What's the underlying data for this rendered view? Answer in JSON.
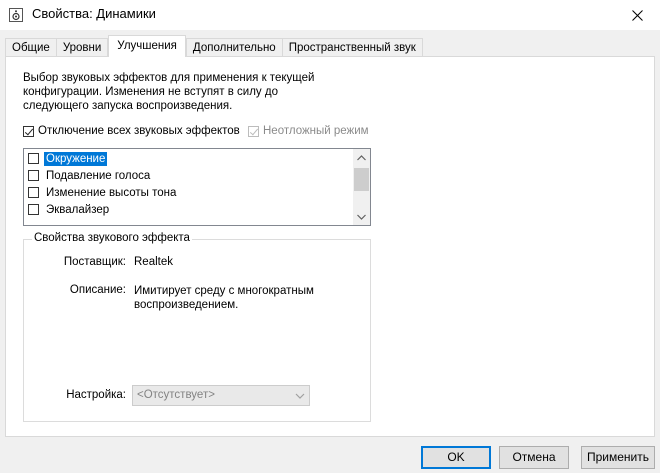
{
  "window": {
    "title": "Свойства: Динамики",
    "close_icon": "close-icon"
  },
  "tabs": [
    {
      "label": "Общие",
      "active": false
    },
    {
      "label": "Уровни",
      "active": false
    },
    {
      "label": "Улучшения",
      "active": true
    },
    {
      "label": "Дополнительно",
      "active": false
    },
    {
      "label": "Пространственный звук",
      "active": false
    }
  ],
  "enhancements": {
    "description": "Выбор звуковых эффектов для применения к текущей конфигурации. Изменения не вступят в силу до следующего запуска воспроизведения.",
    "disable_all": {
      "label": "Отключение всех звуковых эффектов",
      "checked": true
    },
    "urgent_mode": {
      "label": "Неотложный режим",
      "checked": true,
      "disabled": true
    },
    "effects": [
      {
        "label": "Окружение",
        "checked": false,
        "selected": true
      },
      {
        "label": "Подавление голоса",
        "checked": false,
        "selected": false
      },
      {
        "label": "Изменение высоты тона",
        "checked": false,
        "selected": false
      },
      {
        "label": "Эквалайзер",
        "checked": false,
        "selected": false
      }
    ],
    "properties": {
      "group_title": "Свойства звукового эффекта",
      "provider_label": "Поставщик:",
      "provider_value": "Realtek",
      "description_label": "Описание:",
      "description_value": "Имитирует среду с многократным воспроизведением.",
      "setting_label": "Настройка:",
      "setting_value": "<Отсутствует>"
    }
  },
  "buttons": {
    "ok": "OK",
    "cancel": "Отмена",
    "apply": "Применить"
  },
  "colors": {
    "selection": "#0078d7",
    "default_button_border": "#0078d7"
  }
}
